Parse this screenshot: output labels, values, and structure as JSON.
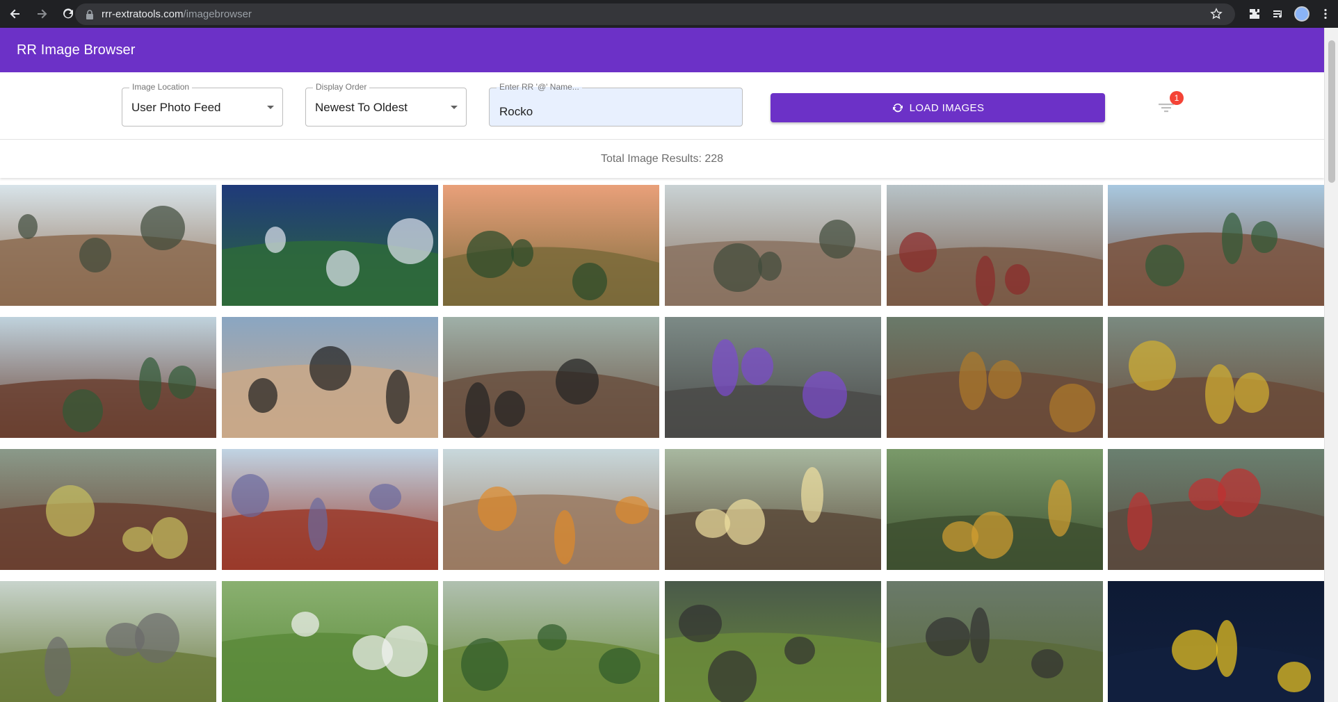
{
  "browser": {
    "url_host": "rrr-extratools.com",
    "url_path": "/imagebrowser"
  },
  "app": {
    "title": "RR Image Browser"
  },
  "controls": {
    "image_location": {
      "label": "Image Location",
      "value": "User Photo Feed"
    },
    "display_order": {
      "label": "Display Order",
      "value": "Newest To Oldest"
    },
    "name_input": {
      "label": "Enter RR '@' Name...",
      "value": "Rocko"
    },
    "load_button": "LOAD IMAGES",
    "filter_badge": "1"
  },
  "results": {
    "text": "Total Image Results: 228"
  },
  "images": [
    {
      "sky": "#d8e4ea",
      "ground": "#8c6b50",
      "accent": "#3e4a3a"
    },
    {
      "sky": "#1f3a7a",
      "ground": "#2e6a3a",
      "accent": "#dfe4f0"
    },
    {
      "sky": "#e9a07a",
      "ground": "#7a6a3a",
      "accent": "#284a2a"
    },
    {
      "sky": "#c9d2d4",
      "ground": "#8a7260",
      "accent": "#3e4a3a"
    },
    {
      "sky": "#b7c3c8",
      "ground": "#7a5a46",
      "accent": "#8b2a2a"
    },
    {
      "sky": "#a8c8e0",
      "ground": "#7a5440",
      "accent": "#2f5a36"
    },
    {
      "sky": "#bfd2dd",
      "ground": "#6a4030",
      "accent": "#2f5a36"
    },
    {
      "sky": "#8aa6c2",
      "ground": "#c9a888",
      "accent": "#1e1e1e"
    },
    {
      "sky": "#9fb0a8",
      "ground": "#6a5040",
      "accent": "#222222"
    },
    {
      "sky": "#7c8a86",
      "ground": "#4a4a48",
      "accent": "#7c4ad0"
    },
    {
      "sky": "#6a7a6a",
      "ground": "#6a4a38",
      "accent": "#b07a2a"
    },
    {
      "sky": "#7a8a80",
      "ground": "#6a4a38",
      "accent": "#d4b030"
    },
    {
      "sky": "#8a9a8a",
      "ground": "#6a4030",
      "accent": "#c8c060"
    },
    {
      "sky": "#c0d4e4",
      "ground": "#9a3a2a",
      "accent": "#6a6aa0"
    },
    {
      "sky": "#c8d8dc",
      "ground": "#9a7a62",
      "accent": "#e08a2a"
    },
    {
      "sky": "#a8b8a0",
      "ground": "#5a4a3a",
      "accent": "#f0e0a0"
    },
    {
      "sky": "#7a9a6a",
      "ground": "#3e5030",
      "accent": "#d4a030"
    },
    {
      "sky": "#6a8070",
      "ground": "#5a4a3e",
      "accent": "#c03030"
    },
    {
      "sky": "#c8d4cc",
      "ground": "#6a7a3a",
      "accent": "#6a6a6a"
    },
    {
      "sky": "#8ab070",
      "ground": "#5a8a3a",
      "accent": "#f4f4f4"
    },
    {
      "sky": "#b0c0b0",
      "ground": "#6a8a3a",
      "accent": "#2e5a2a"
    },
    {
      "sky": "#4a5a4a",
      "ground": "#6a8a3a",
      "accent": "#303030"
    },
    {
      "sky": "#6a7a6a",
      "ground": "#5a6a3a",
      "accent": "#303030"
    },
    {
      "sky": "#0e1a34",
      "ground": "#12203e",
      "accent": "#f0c820"
    }
  ]
}
